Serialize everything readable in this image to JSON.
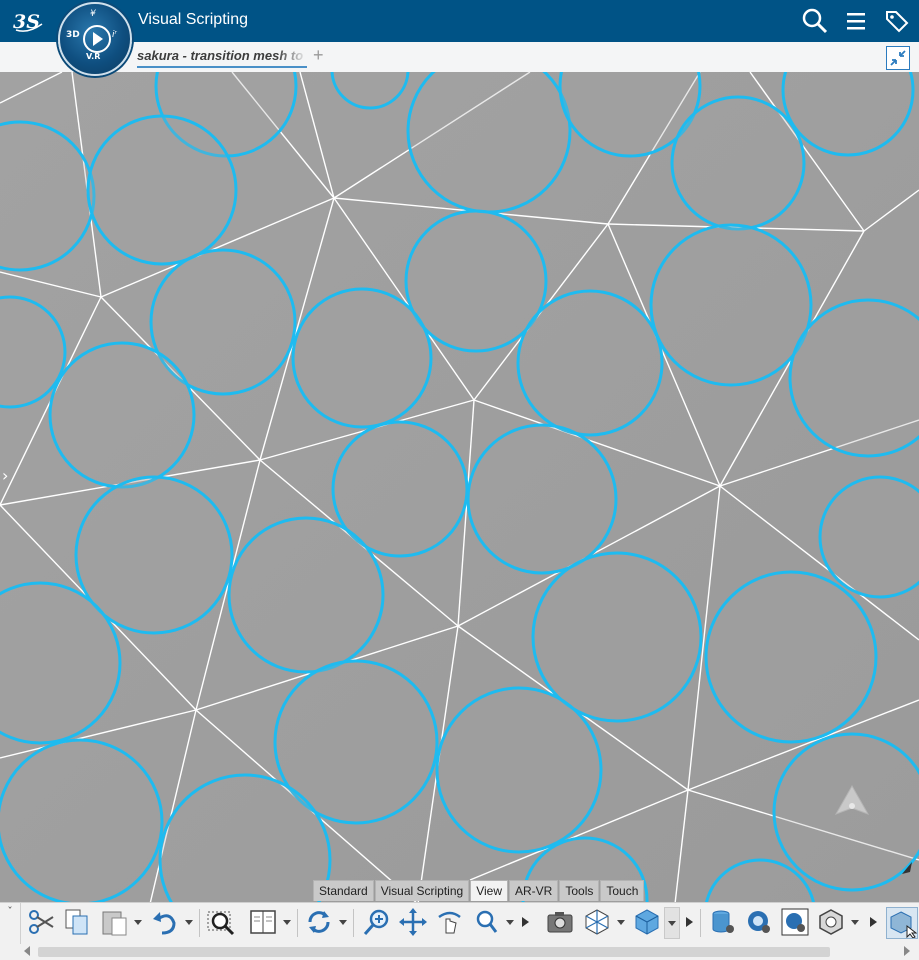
{
  "app": {
    "brand_icon": "ds-logo-icon",
    "compass": {
      "label_3d": "3D",
      "label_vr": "V.R",
      "label_top": "¥",
      "label_right": "iʳ"
    },
    "title": "Visual Scripting"
  },
  "topbar": {
    "search_icon": "search-icon",
    "menu_icon": "hamburger-menu-icon",
    "tag_icon": "tag-icon"
  },
  "document": {
    "tab_label": "sakura - transition mesh to",
    "add_tab": "+"
  },
  "workbench_tabs": [
    {
      "label": "Standard",
      "active": false
    },
    {
      "label": "Visual Scripting",
      "active": false
    },
    {
      "label": "View",
      "active": true
    },
    {
      "label": "AR-VR",
      "active": false
    },
    {
      "label": "Tools",
      "active": false
    },
    {
      "label": "Touch",
      "active": false
    }
  ],
  "action_bar": {
    "left_chevron": "ˇ",
    "icons": [
      "cut-icon",
      "copy-icon",
      "paste-icon",
      "undo-icon",
      "zoom-area-icon",
      "reference-book-icon",
      "refresh-cycle-icon",
      "zoom-in-icon",
      "pan-icon",
      "rotate-icon",
      "zoom-icon",
      "capture-camera-icon",
      "view-cube-icon",
      "solid-box-icon",
      "database-settings-icon",
      "network-settings-icon",
      "globe-settings-icon",
      "hexagon-icon",
      "cube-select-icon"
    ]
  },
  "colors": {
    "topbar": "#005386",
    "circle_stroke": "#1ebbf0",
    "mesh_line": "#ffffff",
    "viewport_bg": "#9c9c9c"
  }
}
